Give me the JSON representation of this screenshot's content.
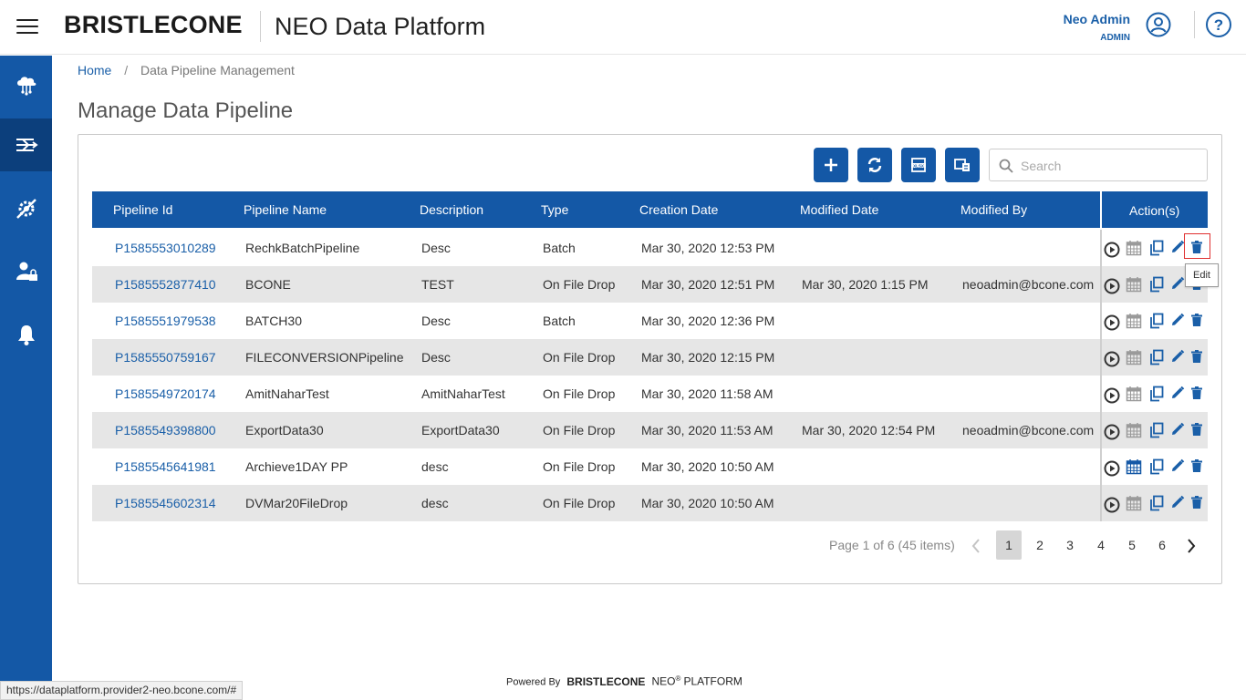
{
  "header": {
    "brand": "BRISTLECONE",
    "app_title": "NEO Data Platform",
    "user_name": "Neo Admin",
    "user_role": "ADMIN"
  },
  "sidebar": {
    "items": [
      {
        "icon": "cloud-network-icon"
      },
      {
        "icon": "pipeline-icon",
        "active": true
      },
      {
        "icon": "settings-tools-icon"
      },
      {
        "icon": "user-lock-icon"
      },
      {
        "icon": "bell-icon"
      }
    ]
  },
  "breadcrumb": {
    "home": "Home",
    "separator": "/",
    "current": "Data Pipeline Management"
  },
  "page_title": "Manage Data Pipeline",
  "toolbar": {
    "buttons": [
      "add-icon",
      "refresh-icon",
      "xlsx-export-icon",
      "import-icon"
    ],
    "search_placeholder": "Search"
  },
  "table": {
    "columns": [
      "Pipeline Id",
      "Pipeline Name",
      "Description",
      "Type",
      "Creation Date",
      "Modified Date",
      "Modified By",
      "Action(s)"
    ],
    "rows": [
      {
        "id": "P1585553010289",
        "name": "RechkBatchPipeline",
        "description": "Desc",
        "type": "Batch",
        "created": "Mar 30, 2020 12:53 PM",
        "modified": "",
        "modified_by": ""
      },
      {
        "id": "P1585552877410",
        "name": "BCONE",
        "description": "TEST",
        "type": "On File Drop",
        "created": "Mar 30, 2020 12:51 PM",
        "modified": "Mar 30, 2020 1:15 PM",
        "modified_by": "neoadmin@bcone.com"
      },
      {
        "id": "P1585551979538",
        "name": "BATCH30",
        "description": "Desc",
        "type": "Batch",
        "created": "Mar 30, 2020 12:36 PM",
        "modified": "",
        "modified_by": ""
      },
      {
        "id": "P1585550759167",
        "name": "FILECONVERSIONPipeline",
        "description": "Desc",
        "type": "On File Drop",
        "created": "Mar 30, 2020 12:15 PM",
        "modified": "",
        "modified_by": ""
      },
      {
        "id": "P1585549720174",
        "name": "AmitNaharTest",
        "description": "AmitNaharTest",
        "type": "On File Drop",
        "created": "Mar 30, 2020 11:58 AM",
        "modified": "",
        "modified_by": ""
      },
      {
        "id": "P1585549398800",
        "name": "ExportData30",
        "description": "ExportData30",
        "type": "On File Drop",
        "created": "Mar 30, 2020 11:53 AM",
        "modified": "Mar 30, 2020 12:54 PM",
        "modified_by": "neoadmin@bcone.com"
      },
      {
        "id": "P1585545641981",
        "name": "Archieve1DAY PP",
        "description": "desc",
        "type": "On File Drop",
        "created": "Mar 30, 2020 10:50 AM",
        "modified": "",
        "modified_by": ""
      },
      {
        "id": "P1585545602314",
        "name": "DVMar20FileDrop",
        "description": "desc",
        "type": "On File Drop",
        "created": "Mar 30, 2020 10:50 AM",
        "modified": "",
        "modified_by": ""
      }
    ]
  },
  "tooltip": "Edit",
  "pagination": {
    "info": "Page 1 of 6 (45 items)",
    "pages": [
      "1",
      "2",
      "3",
      "4",
      "5",
      "6"
    ],
    "current": "1"
  },
  "footer": {
    "powered_by": "Powered By",
    "brand": "BRISTLECONE",
    "neo": "NEO",
    "reg": "®",
    "platform": "PLATFORM"
  },
  "status_url": "https://dataplatform.provider2-neo.bcone.com/#",
  "colors": {
    "primary": "#1458a6",
    "sidebar_active": "#0c3f7c",
    "link": "#1a5fa8",
    "row_alt": "#e6e6e6"
  }
}
